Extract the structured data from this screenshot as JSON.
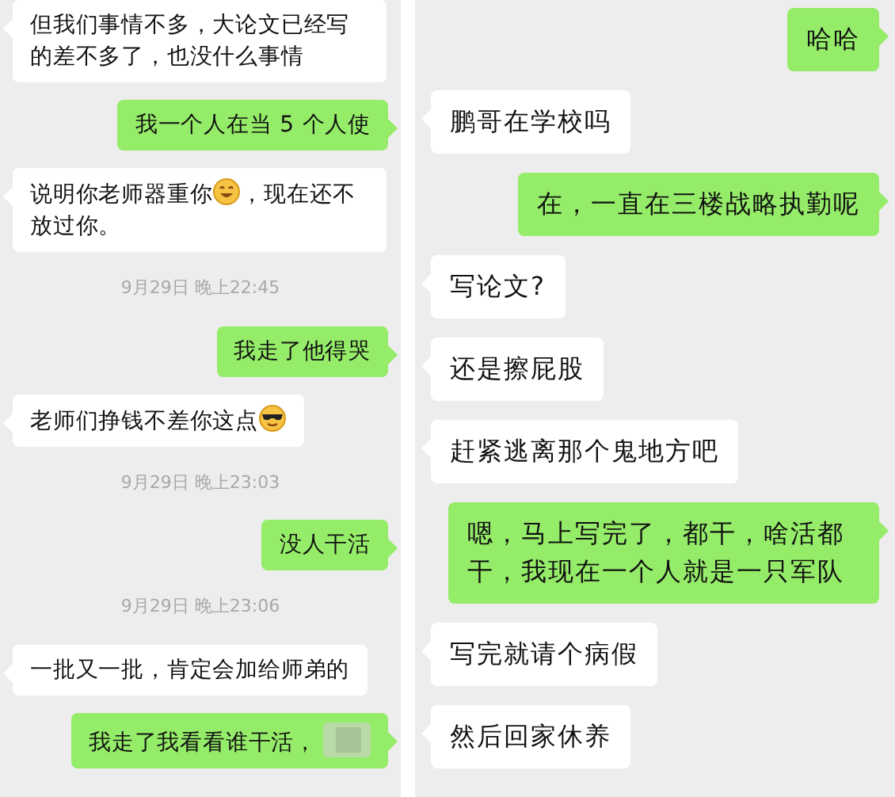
{
  "panels": [
    {
      "items": [
        {
          "kind": "received",
          "parts": [
            {
              "kind": "text",
              "text": "但我们事情不多，大论文已经写的差不多了，也没什么事情"
            }
          ]
        },
        {
          "kind": "sent",
          "parts": [
            {
              "kind": "text",
              "text": "我一个人在当 5 个人使"
            }
          ]
        },
        {
          "kind": "received",
          "parts": [
            {
              "kind": "text",
              "text": "说明你老师器重你"
            },
            {
              "kind": "grin-emoji"
            },
            {
              "kind": "text",
              "text": "，现在还不放过你。"
            }
          ]
        },
        {
          "kind": "time",
          "text": "9月29日 晚上22:45"
        },
        {
          "kind": "sent",
          "parts": [
            {
              "kind": "text",
              "text": "我走了他得哭"
            }
          ]
        },
        {
          "kind": "received",
          "parts": [
            {
              "kind": "text",
              "text": "老师们挣钱不差你这点"
            },
            {
              "kind": "cool-emoji"
            }
          ]
        },
        {
          "kind": "time",
          "text": "9月29日 晚上23:03"
        },
        {
          "kind": "sent",
          "parts": [
            {
              "kind": "text",
              "text": "没人干活"
            }
          ]
        },
        {
          "kind": "time",
          "text": "9月29日 晚上23:06"
        },
        {
          "kind": "received",
          "parts": [
            {
              "kind": "text",
              "text": "一批又一批，肯定会加给师弟的"
            }
          ]
        },
        {
          "kind": "sent",
          "parts": [
            {
              "kind": "text",
              "text": "我走了我看看谁干活，"
            },
            {
              "kind": "blurred"
            }
          ]
        }
      ]
    },
    {
      "items": [
        {
          "kind": "sent",
          "parts": [
            {
              "kind": "text",
              "text": "哈哈"
            }
          ]
        },
        {
          "kind": "received",
          "parts": [
            {
              "kind": "text",
              "text": "鹏哥在学校吗"
            }
          ]
        },
        {
          "kind": "sent",
          "parts": [
            {
              "kind": "text",
              "text": "在，一直在三楼战略执勤呢"
            }
          ]
        },
        {
          "kind": "received",
          "parts": [
            {
              "kind": "text",
              "text": "写论文?"
            }
          ]
        },
        {
          "kind": "received",
          "parts": [
            {
              "kind": "text",
              "text": "还是擦屁股"
            }
          ]
        },
        {
          "kind": "received",
          "parts": [
            {
              "kind": "text",
              "text": "赶紧逃离那个鬼地方吧"
            }
          ]
        },
        {
          "kind": "sent",
          "parts": [
            {
              "kind": "text",
              "text": "嗯，马上写完了，都干，啥活都干，我现在一个人就是一只军队"
            }
          ]
        },
        {
          "kind": "received",
          "parts": [
            {
              "kind": "text",
              "text": "写完就请个病假"
            }
          ]
        },
        {
          "kind": "received",
          "parts": [
            {
              "kind": "text",
              "text": "然后回家休养"
            }
          ]
        }
      ]
    }
  ]
}
